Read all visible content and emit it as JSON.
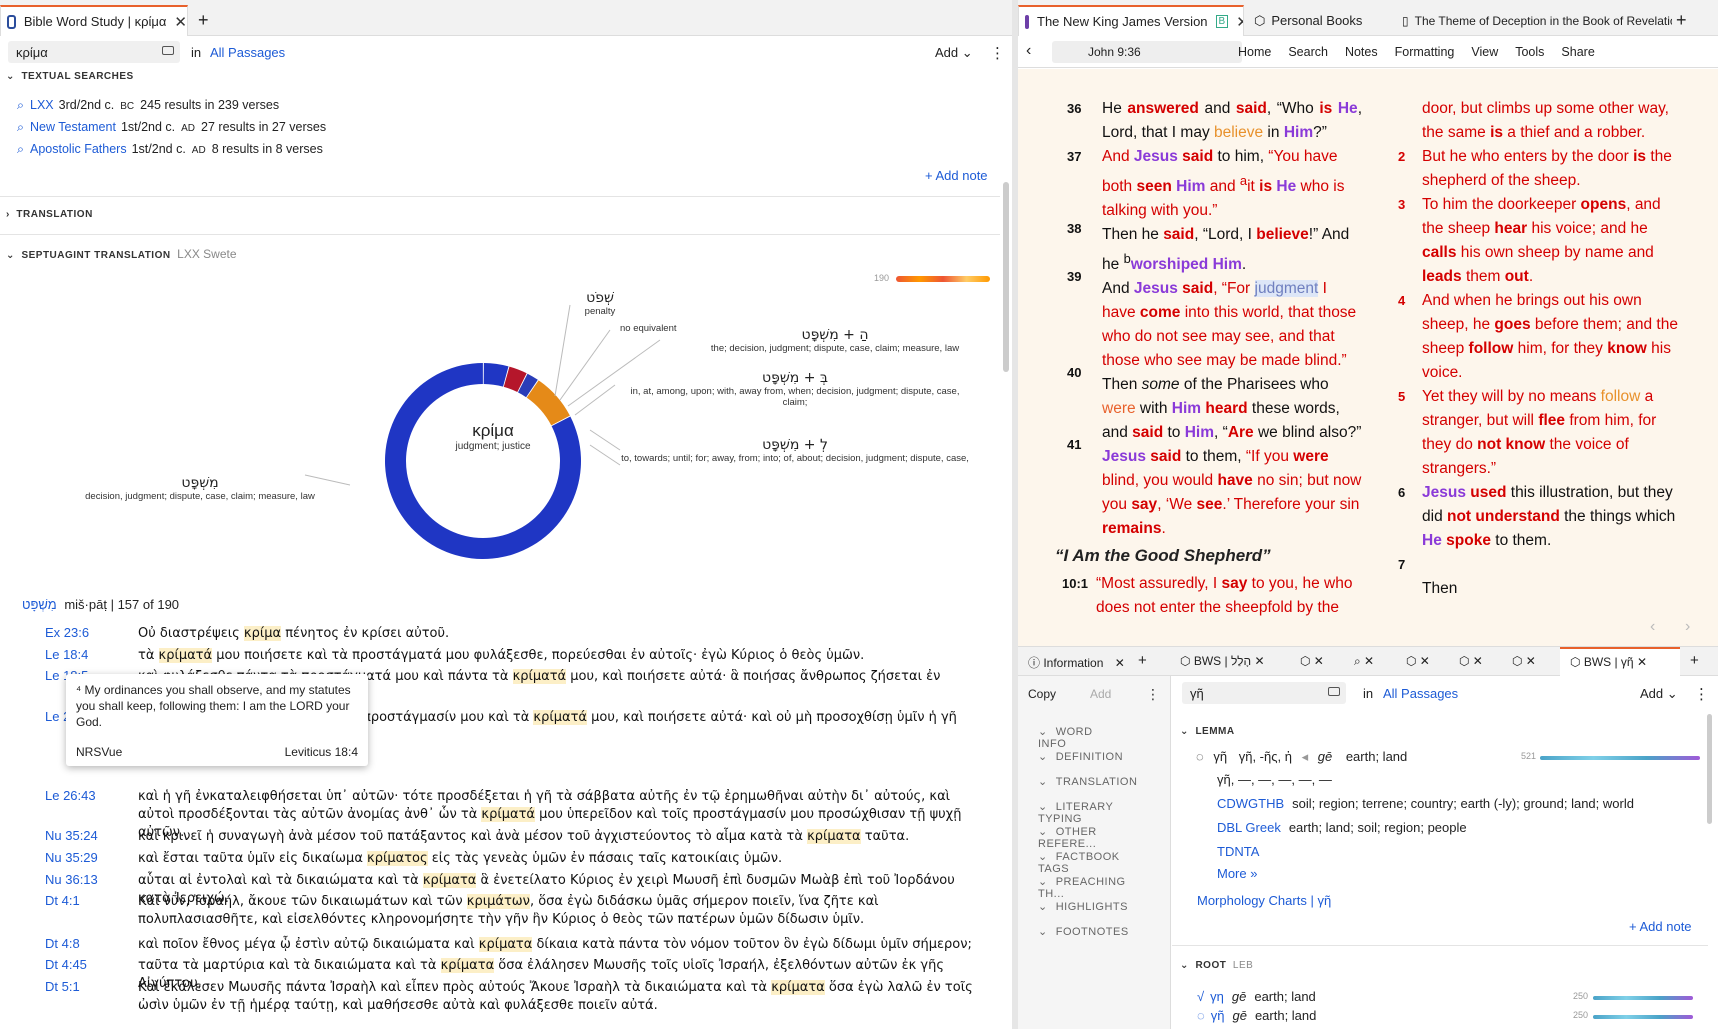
{
  "left_tab": {
    "title": "Bible Word Study | κρίμα",
    "close": "✕",
    "new": "+"
  },
  "search": {
    "value": "κρίμα",
    "in": "in",
    "scope": "All Passages",
    "add": "Add ⌄",
    "menu": "⋮"
  },
  "textual": {
    "title": "TEXTUAL SEARCHES",
    "rows": [
      {
        "name": "LXX",
        "date": "3rd/2nd c.",
        "era": "BC",
        "count": "245 results in 239 verses"
      },
      {
        "name": "New Testament",
        "date": "1st/2nd c.",
        "era": "AD",
        "count": "27 results in 27 verses"
      },
      {
        "name": "Apostolic Fathers",
        "date": "1st/2nd c.",
        "era": "AD",
        "count": "8 results in 8 verses"
      }
    ],
    "add_note": "+ Add note"
  },
  "translation": {
    "title": "TRANSLATION"
  },
  "septuagint": {
    "title": "SEPTUAGINT TRANSLATION",
    "source": "LXX Swete",
    "count": "190"
  },
  "donut": {
    "center": "κρίμα",
    "center_gloss": "judgment; justice",
    "segments": [
      {
        "label": "מִשְׁפָּט",
        "value": 157,
        "color": "#1f36c4"
      },
      {
        "label": "שְׁפֹט",
        "value": 8,
        "color": "#1f36c4"
      },
      {
        "label": "הַ + מִשְׁפָּט",
        "value": 6,
        "color": "#b5162b"
      },
      {
        "label": "בְּ + מִשְׁפָּט",
        "value": 4,
        "color": "#2a3db8"
      },
      {
        "label": "לְ + מִשְׁפָּט",
        "value": 15,
        "color": "#e58a18"
      }
    ],
    "labels": [
      {
        "heb": "שְׁפֹט",
        "gloss": "penalty"
      },
      {
        "heb": "",
        "gloss": "no equivalent"
      },
      {
        "heb": "הַ + מִשְׁפָּט",
        "gloss": "the; decision, judgment; dispute, case, claim; measure, law"
      },
      {
        "heb": "בְּ + מִשְׁפָּט",
        "gloss": "in, at, among, upon; with, away from, when; decision, judgment; dispute, case, claim;"
      },
      {
        "heb": "לְ + מִשְׁפָּט",
        "gloss": "to, towards; until; for; away, from; into; of, about; decision, judgment; dispute, case,"
      },
      {
        "heb": "מִשְׁפָּט",
        "gloss": "decision, judgment; dispute, case, claim; measure, law"
      }
    ]
  },
  "list_header": {
    "heb": "מִשְׁפָּט",
    "translit": "miš·pāṭ",
    "count": "157 of 190"
  },
  "verses": [
    {
      "ref": "Ex 23:6",
      "text": "Οὐ διαστρέψεις κρίμα πένητος ἐν κρίσει αὐτοῦ."
    },
    {
      "ref": "Le 18:4",
      "text": "τὰ κρίματά μου ποιήσετε καὶ τὰ προστάγματά μου φυλάξεσθε, πορεύεσθαι ἐν αὐτοῖς· ἐγὼ Κύριος ὁ θεὸς ὑμῶν."
    },
    {
      "ref": "Le 18:5",
      "text": "καὶ φυλάξεσθε πάντα τὰ προστάγματά μου καὶ πάντα τὰ κρίματά μου, καὶ ποιήσετε αὐτά· ἃ ποιήσας ἄνθρωπος ζήσεται ἐν αὐτοῖς· ἐγὼ Κύριος ὁ"
    },
    {
      "ref": "Le 26:15",
      "text": "ἀλλὰ ἀπειθήσητε αὐτοῖς, καὶ τοῖς προστάγμασίν μου καὶ τὰ κρίματά μου, καὶ ποιήσετε αὐτά· καὶ οὐ μὴ προσοχθίσῃ ὑμῖν ἡ γῆ εἰς ἣν ἐγὼ εἰσάγω ὑμᾶς ἐκεῖ"
    },
    {
      "ref": "Le 26:43",
      "text": "καὶ ἡ γῆ ἐνκαταλειφθήσεται ὑπ᾽ αὐτῶν· τότε προσδέξεται ἡ γῆ τὰ σάββατα αὐτῆς ἐν τῷ ἐρημωθῆναι αὐτὴν δι᾽ αὐτούς, καὶ αὐτοὶ προσδέξονται τὰς αὐτῶν ἀνομίας ἀνθ᾽ ὧν τὰ κρίματά μου ὑπερεῖδον καὶ τοῖς προστάγμασίν μου προσώχθισαν τῇ ψυχῇ αὐτῶν."
    },
    {
      "ref": "Nu 35:24",
      "text": "καὶ κρινεῖ ἡ συναγωγὴ ἀνὰ μέσον τοῦ πατάξαντος καὶ ἀνὰ μέσον τοῦ ἀγχιστεύοντος τὸ αἷμα κατὰ τὰ κρίματα ταῦτα."
    },
    {
      "ref": "Nu 35:29",
      "text": "καὶ ἔσται ταῦτα ὑμῖν εἰς δικαίωμα κρίματος εἰς τὰς γενεὰς ὑμῶν ἐν πάσαις ταῖς κατοικίαις ὑμῶν."
    },
    {
      "ref": "Nu 36:13",
      "text": "αὗται αἱ ἐντολαὶ καὶ τὰ δικαιώματα καὶ τὰ κρίματα ἃ ἐνετείλατο Κύριος ἐν χειρὶ Μωυσῆ ἐπὶ δυσμῶν Μωὰβ ἐπὶ τοῦ Ἰορδάνου κατὰ Ἰερειχώ."
    },
    {
      "ref": "Dt 4:1",
      "text": "Καὶ νῦν, Ἰσραήλ, ἄκουε τῶν δικαιωμάτων καὶ τῶν κριμάτων, ὅσα ἐγὼ διδάσκω ὑμᾶς σήμερον ποιεῖν, ἵνα ζῆτε καὶ πολυπλασιασθῆτε, καὶ εἰσελθόντες κληρονομήσητε τὴν γῆν ἣν Κύριος ὁ θεὸς τῶν πατέρων ὑμῶν δίδωσιν ὑμῖν."
    },
    {
      "ref": "Dt 4:8",
      "text": "καὶ ποῖον ἔθνος μέγα ᾧ ἐστὶν αὐτῷ δικαιώματα καὶ κρίματα δίκαια κατὰ πάντα τὸν νόμον τοῦτον ὃν ἐγὼ δίδωμι ὑμῖν σήμερον;"
    },
    {
      "ref": "Dt 4:45",
      "text": "ταῦτα τὰ μαρτύρια καὶ τὰ δικαιώματα καὶ τὰ κρίματα ὅσα ἐλάλησεν Μωυσῆς τοῖς υἱοῖς Ἰσραήλ, ἐξελθόντων αὐτῶν ἐκ γῆς Αἰγύπτου,"
    },
    {
      "ref": "Dt 5:1",
      "text": "Καὶ ἐκάλεσεν Μωυσῆς πάντα Ἰσραὴλ καὶ εἶπεν πρὸς αὐτούς Ἄκουε Ἰσραὴλ τὰ δικαιώματα καὶ τὰ κρίματα ὅσα ἐγὼ λαλῶ ἐν τοῖς ὠσὶν ὑμῶν ἐν τῇ ἡμέρᾳ ταύτῃ, καὶ μαθήσεσθε αὐτὰ καὶ φυλάξεσθε ποιεῖν αὐτά."
    }
  ],
  "popup": {
    "text": "⁴ My ordinances you shall observe, and my statutes you shall keep, following them: I am the LORD your God.",
    "version": "NRSVue",
    "ref": "Leviticus 18:4"
  },
  "right_tabs": [
    {
      "title": "The New King James Version",
      "badge": "B"
    },
    {
      "title": "Personal Books"
    },
    {
      "title": "The Theme of Deception in the Book of Revelation"
    }
  ],
  "bible_toolbar": {
    "ref": "John 9:36",
    "menu": [
      "Home",
      "Search",
      "Notes",
      "Formatting",
      "View",
      "Tools",
      "Share"
    ]
  },
  "heading": "“I Am the Good Shepherd”",
  "bottom_tabs": [
    "Information",
    "BWS | הָלַל",
    "BWS | γῆ"
  ],
  "bws2": {
    "copy": "Copy",
    "add": "Add",
    "search": "γῆ",
    "in": "in",
    "scope": "All Passages",
    "addbtn": "Add ⌄",
    "nav": [
      "WORD INFO",
      "DEFINITION",
      "TRANSLATION",
      "LITERARY TYPING",
      "OTHER REFERE...",
      "FACTBOOK TAGS",
      "PREACHING TH...",
      "HIGHLIGHTS",
      "FOOTNOTES"
    ],
    "lemma_title": "LEMMA",
    "lemma": "γῆ",
    "lemma_forms": "γῆ, -ῆς, ἡ",
    "translit": "gē",
    "gloss": "earth; land",
    "count": "521",
    "lemma_forms2": "γῆ, —, —, —, —, —",
    "defs": [
      {
        "src": "CDWGTHB",
        "text": "soil; region; terrene; country; earth (-ly); ground; land; world"
      },
      {
        "src": "DBL Greek",
        "text": "earth; land; soil; region; people"
      },
      {
        "src": "TDNTA",
        "text": ""
      }
    ],
    "more": "More »",
    "morph": "Morphology Charts",
    "morph_word": "γῆ",
    "add_note": "+ Add note",
    "root_title": "ROOT",
    "root_src": "LEB",
    "roots": [
      {
        "word": "γη",
        "tr": "gē",
        "gloss": "earth; land",
        "count": "250"
      },
      {
        "word": "γῆ",
        "tr": "gē",
        "gloss": "earth; land",
        "count": "250"
      }
    ]
  }
}
